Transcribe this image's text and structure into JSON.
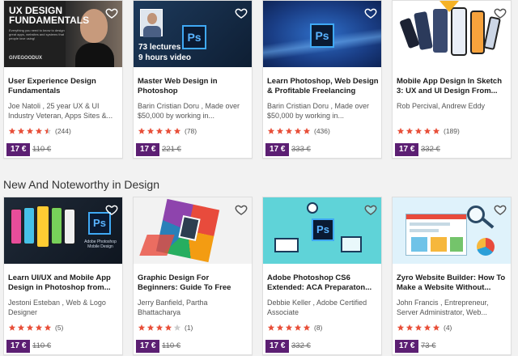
{
  "section_title": "New And Noteworthy in Design",
  "colors": {
    "price_bg": "#5c1f73",
    "star": "#e8503a",
    "star_empty": "#cccccc"
  },
  "rows": [
    {
      "courses": [
        {
          "title": "User Experience Design Fundamentals",
          "author": "Joe Natoli , 25 year UX & UI Industry Veteran, Apps Sites &...",
          "rating_stars": 4.5,
          "rating_count": "(244)",
          "price": "17 €",
          "old_price": "110 €",
          "thumb": {
            "heading": "UX DESIGN\nFUNDAMENTALS",
            "subtext": "Everything you need to know to design great apps, websites and systems that people love using!",
            "logo": "GIVEGOODUX"
          }
        },
        {
          "title": "Master Web Design in Photoshop",
          "author": "Barin Cristian Doru , Made over $50,000 by working in...",
          "rating_stars": 5,
          "rating_count": "(78)",
          "price": "17 €",
          "old_price": "221 €",
          "thumb": {
            "lectures": "73 lectures",
            "video": "9 hours video",
            "badge": "Ps"
          }
        },
        {
          "title": "Learn Photoshop, Web Design & Profitable Freelancing",
          "author": "Barin Cristian Doru , Made over $50,000 by working in...",
          "rating_stars": 5,
          "rating_count": "(436)",
          "price": "17 €",
          "old_price": "333 €",
          "thumb": {
            "badge": "Ps"
          }
        },
        {
          "title": "Mobile App Design In Sketch 3: UX and UI Design From...",
          "author": "Rob Percival, Andrew Eddy",
          "rating_stars": 5,
          "rating_count": "(189)",
          "price": "17 €",
          "old_price": "332 €",
          "thumb": {}
        }
      ]
    },
    {
      "courses": [
        {
          "title": "Learn UI/UX and Mobile App Design in Photoshop from...",
          "author": "Jestoni Esteban , Web & Logo Designer",
          "rating_stars": 5,
          "rating_count": "(5)",
          "price": "17 €",
          "old_price": "110 €",
          "thumb": {
            "badge": "Ps",
            "caption": "Adobe Photoshop Mobile Design"
          }
        },
        {
          "title": "Graphic Design For Beginners: Guide To Free Great...",
          "author": "Jerry Banfield, Partha Bhattacharya",
          "rating_stars": 4,
          "rating_count": "(1)",
          "price": "17 €",
          "old_price": "110 €",
          "thumb": {}
        },
        {
          "title": "Adobe Photoshop CS6 Extended: ACA Preparaton...",
          "author": "Debbie Keller , Adobe Certified Associate",
          "rating_stars": 5,
          "rating_count": "(8)",
          "price": "17 €",
          "old_price": "332 €",
          "thumb": {
            "badge": "Ps"
          }
        },
        {
          "title": "Zyro Website Builder: How To Make a Website Without...",
          "author": "John Francis , Entrepreneur, Server Administrator, Web...",
          "rating_stars": 5,
          "rating_count": "(4)",
          "price": "17 €",
          "old_price": "73 €",
          "thumb": {}
        }
      ]
    }
  ]
}
